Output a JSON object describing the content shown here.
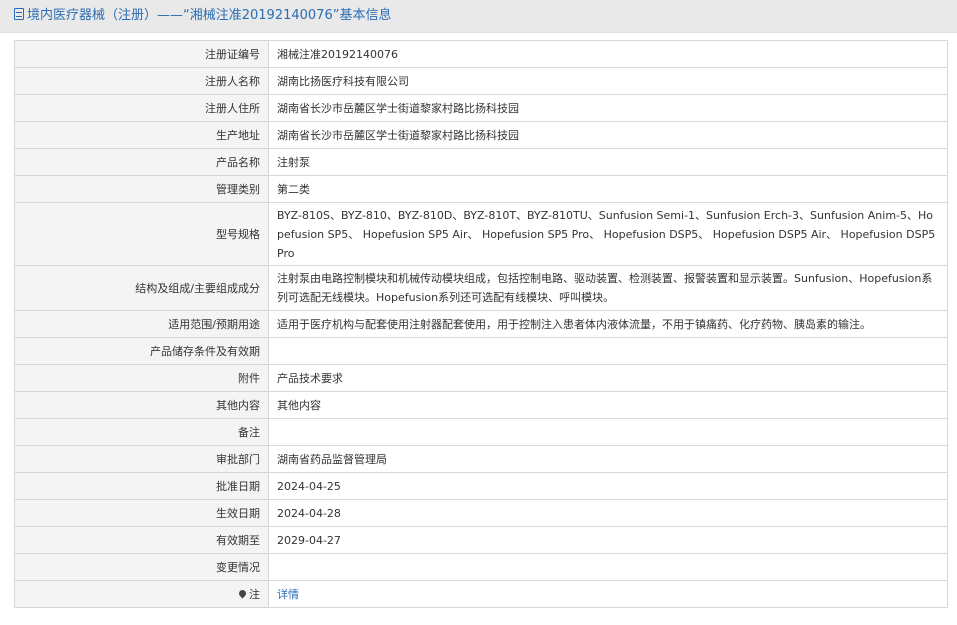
{
  "header": {
    "title": "境内医疗器械（注册）——“湘械注准20192140076”基本信息"
  },
  "rows": [
    {
      "label": "注册证编号",
      "value": "湘械注准20192140076"
    },
    {
      "label": "注册人名称",
      "value": "湖南比扬医疗科技有限公司"
    },
    {
      "label": "注册人住所",
      "value": "湖南省长沙市岳麓区学士街道黎家村路比扬科技园"
    },
    {
      "label": "生产地址",
      "value": "湖南省长沙市岳麓区学士街道黎家村路比扬科技园"
    },
    {
      "label": "产品名称",
      "value": "注射泵"
    },
    {
      "label": "管理类别",
      "value": "第二类"
    },
    {
      "label": "型号规格",
      "value": "BYZ-810S、BYZ-810、BYZ-810D、BYZ-810T、BYZ-810TU、Sunfusion Semi-1、Sunfusion Erch-3、Sunfusion Anim-5、Hopefusion SP5、 Hopefusion SP5 Air、 Hopefusion SP5 Pro、 Hopefusion DSP5、 Hopefusion DSP5 Air、 Hopefusion DSP5 Pro"
    },
    {
      "label": "结构及组成/主要组成成分",
      "value": "注射泵由电路控制模块和机械传动模块组成，包括控制电路、驱动装置、检测装置、报警装置和显示装置。Sunfusion、Hopefusion系列可选配无线模块。Hopefusion系列还可选配有线模块、呼叫模块。"
    },
    {
      "label": "适用范围/预期用途",
      "value": "适用于医疗机构与配套使用注射器配套使用，用于控制注入患者体内液体流量，不用于镇痛药、化疗药物、胰岛素的输注。"
    },
    {
      "label": "产品储存条件及有效期",
      "value": ""
    },
    {
      "label": "附件",
      "value": "产品技术要求"
    },
    {
      "label": "其他内容",
      "value": "其他内容"
    },
    {
      "label": "备注",
      "value": ""
    },
    {
      "label": "审批部门",
      "value": "湖南省药品监督管理局"
    },
    {
      "label": "批准日期",
      "value": "2024-04-25"
    },
    {
      "label": "生效日期",
      "value": "2024-04-28"
    },
    {
      "label": "有效期至",
      "value": "2029-04-27"
    },
    {
      "label": "变更情况",
      "value": ""
    },
    {
      "label": "注",
      "value": "详情"
    }
  ],
  "icons": {
    "header_icon": "document-icon",
    "note_icon": "pin-icon"
  },
  "colors": {
    "accent": "#2a6db4",
    "label_bg": "#f4f4f4",
    "header_bg": "#e9e9e9",
    "border": "#d8d8d8"
  }
}
